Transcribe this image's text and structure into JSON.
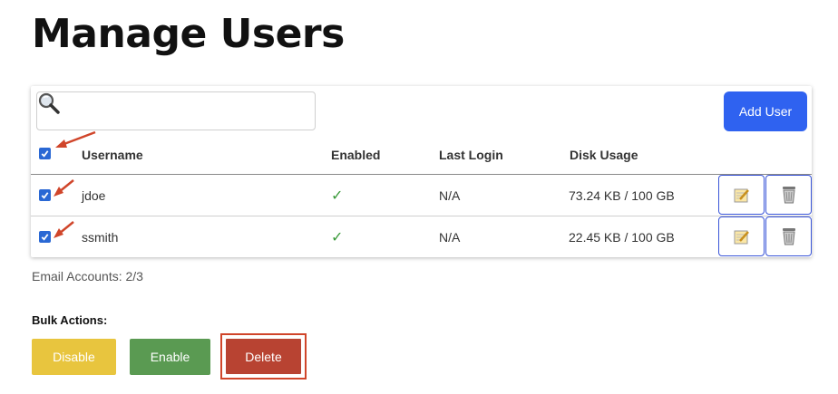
{
  "page": {
    "title": "Manage Users"
  },
  "search": {
    "placeholder": "",
    "value": ""
  },
  "toolbar": {
    "add_user_label": "Add User"
  },
  "table": {
    "headers": {
      "username": "Username",
      "enabled": "Enabled",
      "last_login": "Last Login",
      "disk_usage": "Disk Usage"
    },
    "select_all_checked": true,
    "rows": [
      {
        "selected": true,
        "username": "jdoe",
        "enabled": "✓",
        "last_login": "N/A",
        "disk_usage": "73.24 KB / 100 GB"
      },
      {
        "selected": true,
        "username": "ssmith",
        "enabled": "✓",
        "last_login": "N/A",
        "disk_usage": "22.45 KB / 100 GB"
      }
    ]
  },
  "footer": {
    "email_accounts": "Email Accounts: 2/3"
  },
  "bulk": {
    "label": "Bulk Actions:",
    "disable_label": "Disable",
    "enable_label": "Enable",
    "delete_label": "Delete"
  },
  "colors": {
    "primary": "#2f62f0",
    "disable": "#e8c53e",
    "enable": "#5a9a52",
    "delete": "#b84332",
    "annotation": "#d0452a"
  },
  "icons": {
    "search": "magnifier-icon",
    "edit": "edit-note-icon",
    "delete": "trash-can-icon",
    "annotation": "arrow-annotation-icon"
  }
}
